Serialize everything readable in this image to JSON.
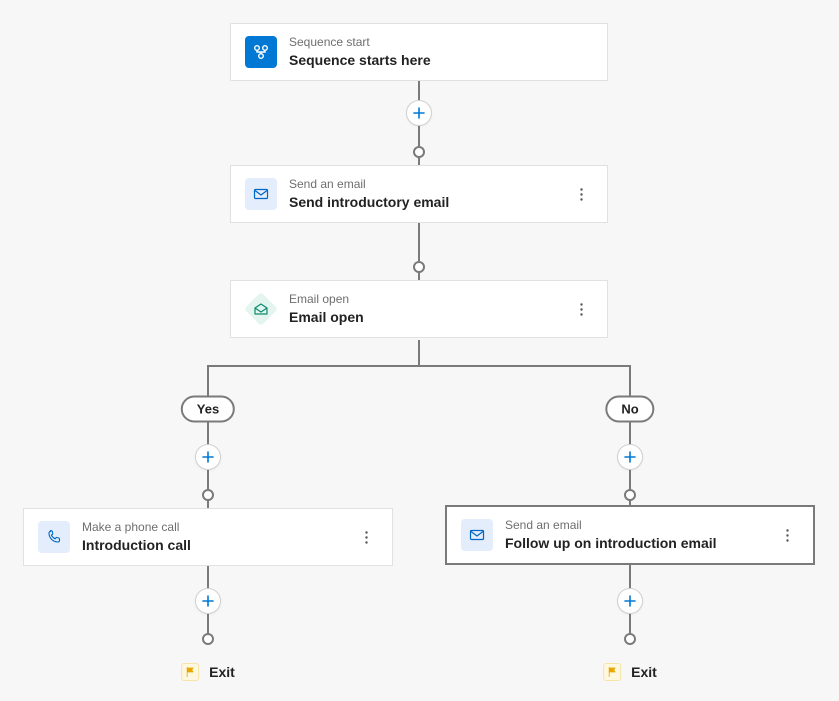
{
  "nodes": {
    "start": {
      "type": "Sequence start",
      "title": "Sequence starts here"
    },
    "email1": {
      "type": "Send an email",
      "title": "Send introductory email"
    },
    "condition": {
      "type": "Email open",
      "title": "Email open"
    },
    "call": {
      "type": "Make a phone call",
      "title": "Introduction call"
    },
    "email2": {
      "type": "Send an email",
      "title": "Follow up on introduction email"
    }
  },
  "branches": {
    "yes": "Yes",
    "no": "No"
  },
  "exit_label": "Exit"
}
